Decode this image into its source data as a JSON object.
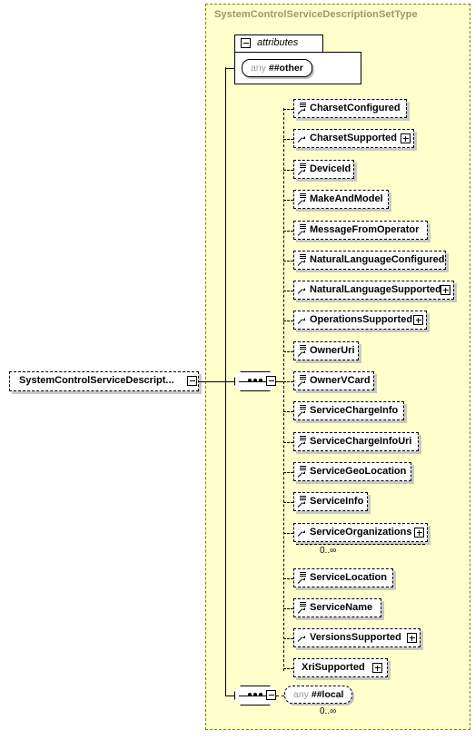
{
  "diagram": {
    "kind": "xml-schema-diagram",
    "type_name": "SystemControlServiceDescriptionSetType",
    "root_element": {
      "label": "SystemControlServiceDescript...",
      "expander": "minus"
    },
    "attributes_group": {
      "label": "attributes",
      "expander": "minus",
      "wildcard": {
        "any": "any",
        "namespace": "##other"
      }
    },
    "sequence_symbol": "sequence-compositor",
    "elements": [
      {
        "label": "CharsetConfigured",
        "expander": null,
        "icon": "element-icon",
        "occurs": null
      },
      {
        "label": "CharsetSupported",
        "expander": "plus",
        "icon": "arrow-icon",
        "occurs": null
      },
      {
        "label": "DeviceId",
        "expander": null,
        "icon": "element-icon",
        "occurs": null
      },
      {
        "label": "MakeAndModel",
        "expander": null,
        "icon": "element-icon",
        "occurs": null
      },
      {
        "label": "MessageFromOperator",
        "expander": null,
        "icon": "element-icon",
        "occurs": null
      },
      {
        "label": "NaturalLanguageConfigured",
        "expander": null,
        "icon": "element-icon",
        "occurs": null
      },
      {
        "label": "NaturalLanguageSupported",
        "expander": "plus",
        "icon": "arrow-icon",
        "occurs": null
      },
      {
        "label": "OperationsSupported",
        "expander": "plus",
        "icon": "arrow-icon",
        "occurs": null
      },
      {
        "label": "OwnerUri",
        "expander": null,
        "icon": "element-icon",
        "occurs": null
      },
      {
        "label": "OwnerVCard",
        "expander": null,
        "icon": "element-icon",
        "occurs": null
      },
      {
        "label": "ServiceChargeInfo",
        "expander": null,
        "icon": "element-icon",
        "occurs": null
      },
      {
        "label": "ServiceChargeInfoUri",
        "expander": null,
        "icon": "element-icon",
        "occurs": null
      },
      {
        "label": "ServiceGeoLocation",
        "expander": null,
        "icon": "element-icon",
        "occurs": null
      },
      {
        "label": "ServiceInfo",
        "expander": null,
        "icon": "element-icon",
        "occurs": null
      },
      {
        "label": "ServiceOrganizations",
        "expander": "plus",
        "icon": "arrow-icon",
        "occurs": "0..∞"
      },
      {
        "label": "ServiceLocation",
        "expander": null,
        "icon": "element-icon",
        "occurs": null
      },
      {
        "label": "ServiceName",
        "expander": null,
        "icon": "element-icon",
        "occurs": null
      },
      {
        "label": "VersionsSupported",
        "expander": "plus",
        "icon": "arrow-icon",
        "occurs": null
      },
      {
        "label": "XriSupported",
        "expander": "plus",
        "icon": null,
        "occurs": null
      }
    ],
    "trailing_sequence": {
      "symbol": "sequence-compositor",
      "expander": "minus",
      "wildcard": {
        "any": "any",
        "namespace": "##local"
      },
      "occurs": "0..∞"
    },
    "colors": {
      "type_background": "#ffffcc",
      "type_border": "#808000",
      "title_text": "#999966",
      "box_fill": "#ffffff",
      "box_border": "#000000",
      "shadow": "#c8c8c8",
      "any_word": "#999999"
    }
  }
}
